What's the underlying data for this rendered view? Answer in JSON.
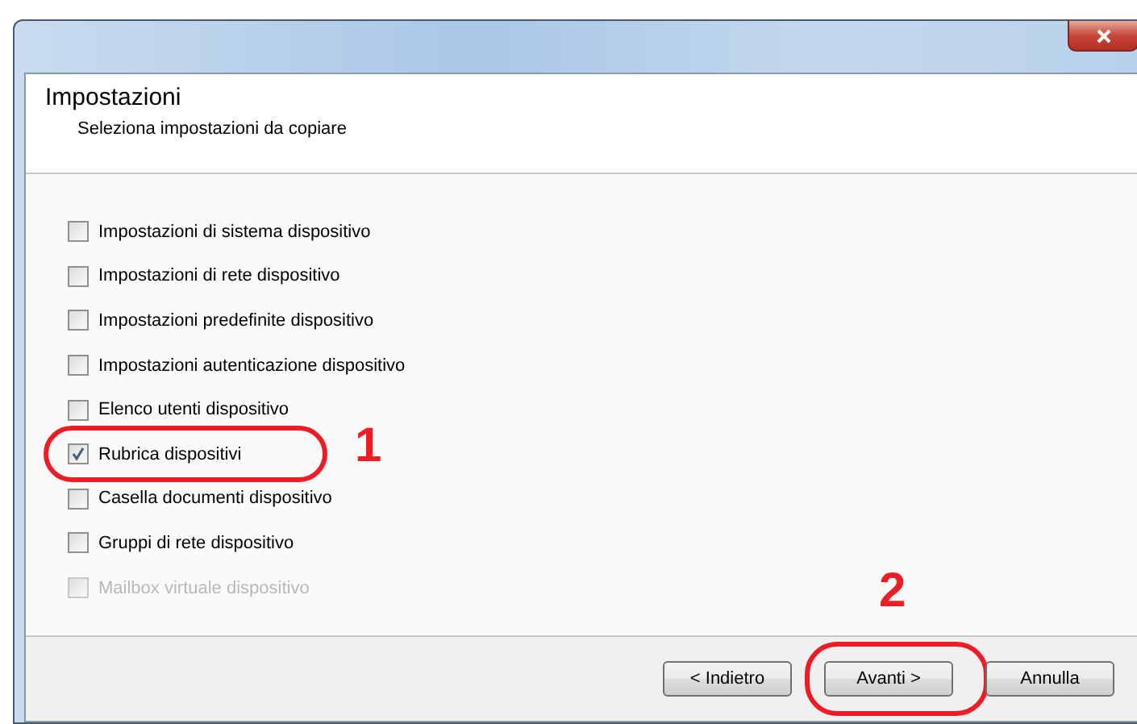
{
  "header": {
    "title": "Impostazioni",
    "subtitle": "Seleziona impostazioni da copiare"
  },
  "options": [
    {
      "label": "Impostazioni di sistema dispositivo",
      "checked": false,
      "disabled": false
    },
    {
      "label": "Impostazioni di rete dispositivo",
      "checked": false,
      "disabled": false
    },
    {
      "label": "Impostazioni predefinite dispositivo",
      "checked": false,
      "disabled": false
    },
    {
      "label": "Impostazioni autenticazione dispositivo",
      "checked": false,
      "disabled": false
    },
    {
      "label": "Elenco utenti dispositivo",
      "checked": false,
      "disabled": false
    },
    {
      "label": "Rubrica dispositivi",
      "checked": true,
      "disabled": false,
      "callout": "1"
    },
    {
      "label": "Casella documenti dispositivo",
      "checked": false,
      "disabled": false
    },
    {
      "label": "Gruppi di rete dispositivo",
      "checked": false,
      "disabled": false
    },
    {
      "label": "Mailbox virtuale dispositivo",
      "checked": false,
      "disabled": true
    }
  ],
  "buttons": [
    {
      "label": "< Indietro"
    },
    {
      "label": "Avanti >",
      "callout": "2"
    },
    {
      "label": "Annulla"
    }
  ]
}
